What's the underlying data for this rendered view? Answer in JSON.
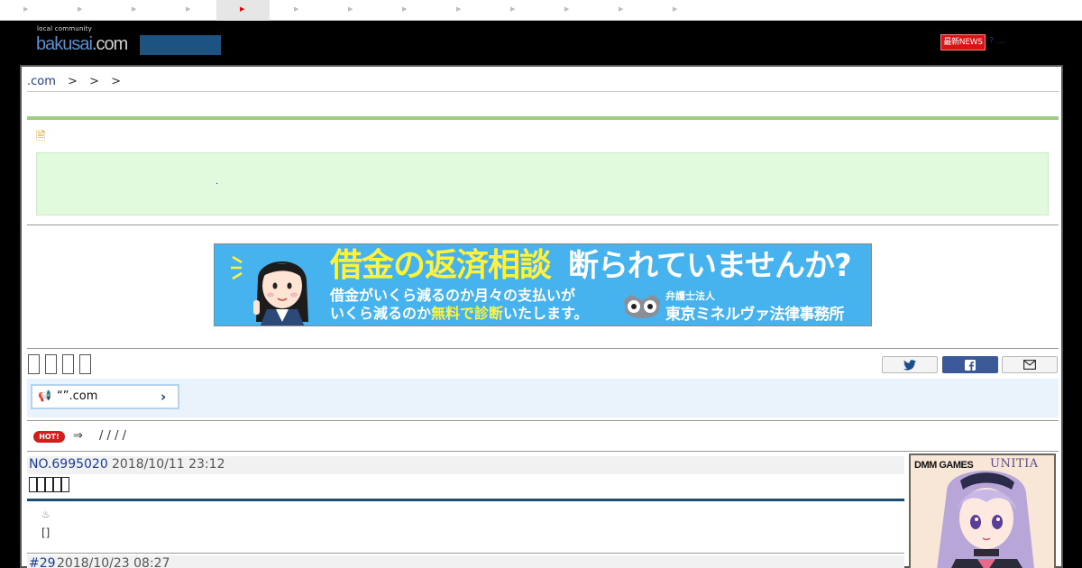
{
  "topnav": {
    "tab_count": 13,
    "active_index": 4
  },
  "header": {
    "logo_tag": "local community",
    "logo_word": "bakusai",
    "logo_dot": ".",
    "logo_com": "com",
    "news_badge": "最新NEWS",
    "news_more": "? ..."
  },
  "breadcrumb": {
    "home": ".com",
    "separators": [
      ">",
      ">",
      ">"
    ]
  },
  "notice": {
    "icon": "doc-icon",
    "text": "."
  },
  "ad_banner": {
    "headline_yellow": "借金の返済相談",
    "headline_white": "断られていませんか?",
    "line2": "借金がいくら減るのか月々の支払いが",
    "line3_a": "いくら減るのか",
    "line3_b": "無料で診断",
    "line3_c": "いたします。",
    "firm_small": "弁護士法人",
    "firm_name": "東京ミネルヴァ法律事務所"
  },
  "share": {
    "twitter": "twitter-icon",
    "facebook": "facebook-icon",
    "mail": "mail-icon"
  },
  "pr": {
    "text": "“”.com",
    "chevron": "›"
  },
  "hot": {
    "badge": "HOT!",
    "arrow": "⇒",
    "links": "/ / / /"
  },
  "post": {
    "number": "NO.6995020",
    "date": "2018/10/11 23:12",
    "hot_spring": "♨",
    "brackets": "[]"
  },
  "reply": {
    "number": "#29",
    "date": "2018/10/23 08:27"
  },
  "side_ad": {
    "brand": "DMM GAMES",
    "title": "UNITIA"
  },
  "colors": {
    "brand_blue": "#1a3c9a",
    "rule_navy": "#1d4b72",
    "notice_green": "#e1f9dc",
    "hot_red": "#d91a1a"
  }
}
